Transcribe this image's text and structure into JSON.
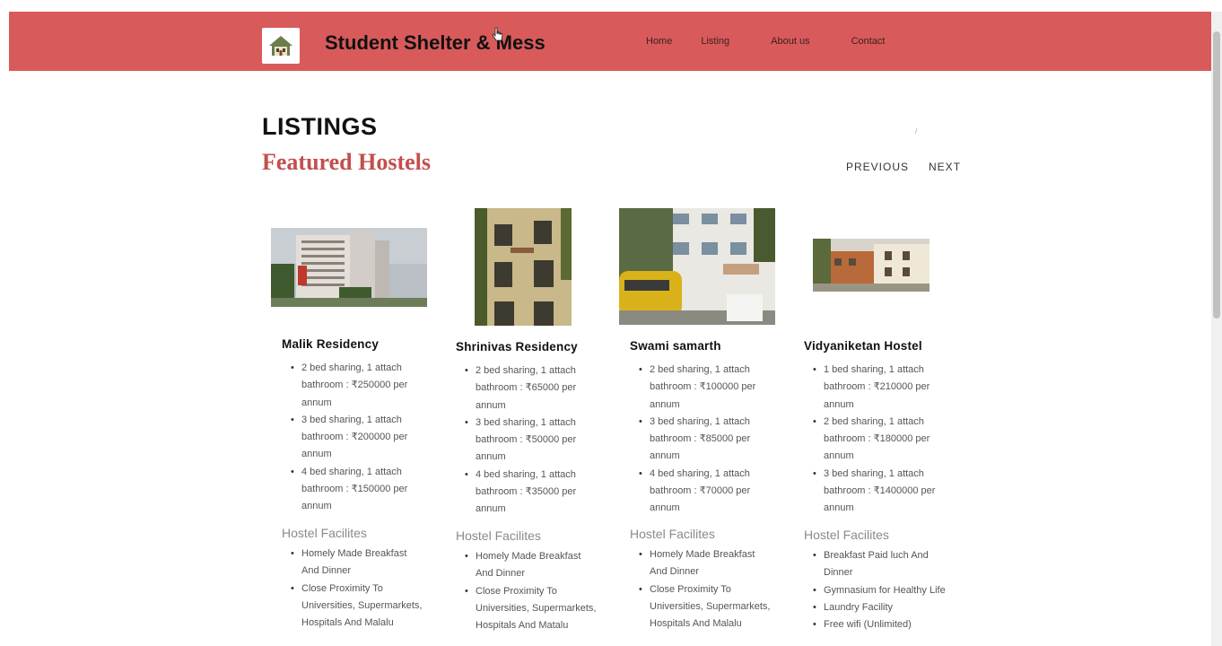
{
  "brand": {
    "title": "Student Shelter & Mess",
    "logo_icon": "house-logo-icon"
  },
  "nav": {
    "home": "Home",
    "listing": "Listing",
    "about": "About us",
    "contact": "Contact"
  },
  "page": {
    "title": "LISTINGS",
    "subtitle": "Featured Hostels",
    "mark": "/"
  },
  "pager": {
    "previous": "PREVIOUS",
    "next": "NEXT"
  },
  "facilities_heading": "Hostel Facilites",
  "colors": {
    "navbar": "#d95a5a",
    "accent": "#c44e4e"
  },
  "hostels": [
    {
      "name": "Malik Residency",
      "rooms": [
        "2 bed sharing, 1 attach bathroom : ₹250000 per annum",
        "3 bed sharing, 1 attach bathroom : ₹200000 per annum",
        "4 bed sharing, 1 attach bathroom : ₹150000 per annum"
      ],
      "facilities": [
        "Homely Made Breakfast And Dinner",
        "Close Proximity To Universities, Supermarkets, Hospitals And Malalu"
      ]
    },
    {
      "name": "Shrinivas Residency",
      "rooms": [
        "2 bed sharing, 1 attach bathroom : ₹65000 per annum",
        "3 bed sharing, 1 attach bathroom : ₹50000 per annum",
        "4 bed sharing, 1 attach bathroom : ₹35000 per annum"
      ],
      "facilities": [
        "Homely Made Breakfast And Dinner",
        "Close Proximity To Universities, Supermarkets, Hospitals And Matalu"
      ]
    },
    {
      "name": "Swami samarth",
      "rooms": [
        "2 bed sharing, 1 attach bathroom : ₹100000 per annum",
        "3 bed sharing, 1 attach bathroom : ₹85000 per annum",
        "4 bed sharing, 1 attach bathroom : ₹70000 per annum"
      ],
      "facilities": [
        "Homely Made Breakfast And Dinner",
        "Close Proximity To Universities, Supermarkets, Hospitals And Malalu"
      ]
    },
    {
      "name": "Vidyaniketan Hostel",
      "rooms": [
        "1 bed sharing, 1 attach bathroom : ₹210000 per annum",
        "2 bed sharing, 1 attach bathroom : ₹180000 per annum",
        "3 bed sharing, 1 attach bathroom : ₹1400000 per annum"
      ],
      "facilities": [
        "Breakfast Paid luch And Dinner",
        "Gymnasium for Healthy Life",
        "Laundry Facility",
        "Free wifi (Unlimited)"
      ]
    }
  ]
}
